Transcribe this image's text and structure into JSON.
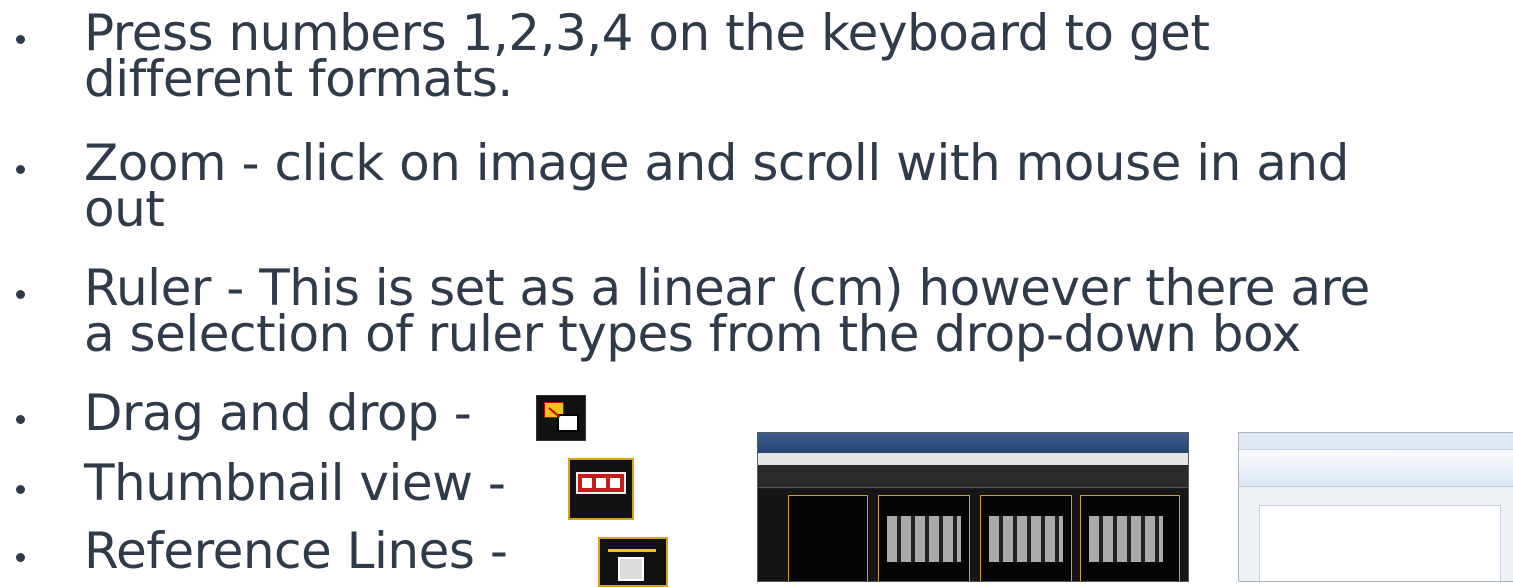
{
  "bullets": [
    {
      "lines": [
        "Press numbers 1,2,3,4 on the keyboard to get",
        "different formats."
      ]
    },
    {
      "lines": [
        "Zoom - click on image and scroll with mouse in and",
        "out"
      ]
    },
    {
      "lines": [
        "Ruler - This is set as a linear (cm) however there are",
        "a selection of ruler types from the drop-down box"
      ]
    },
    {
      "lines": [
        "Drag and drop -"
      ]
    },
    {
      "lines": [
        "Thumbnail view -"
      ]
    },
    {
      "lines": [
        "Reference Lines -"
      ]
    }
  ],
  "icons": {
    "drag_drop": "drag-drop-icon",
    "thumbnail": "thumbnail-view-icon",
    "reference": "reference-lines-icon"
  },
  "colors": {
    "text": "#2f3a4a",
    "accent": "#d7a21f",
    "red": "#c41b1b"
  }
}
